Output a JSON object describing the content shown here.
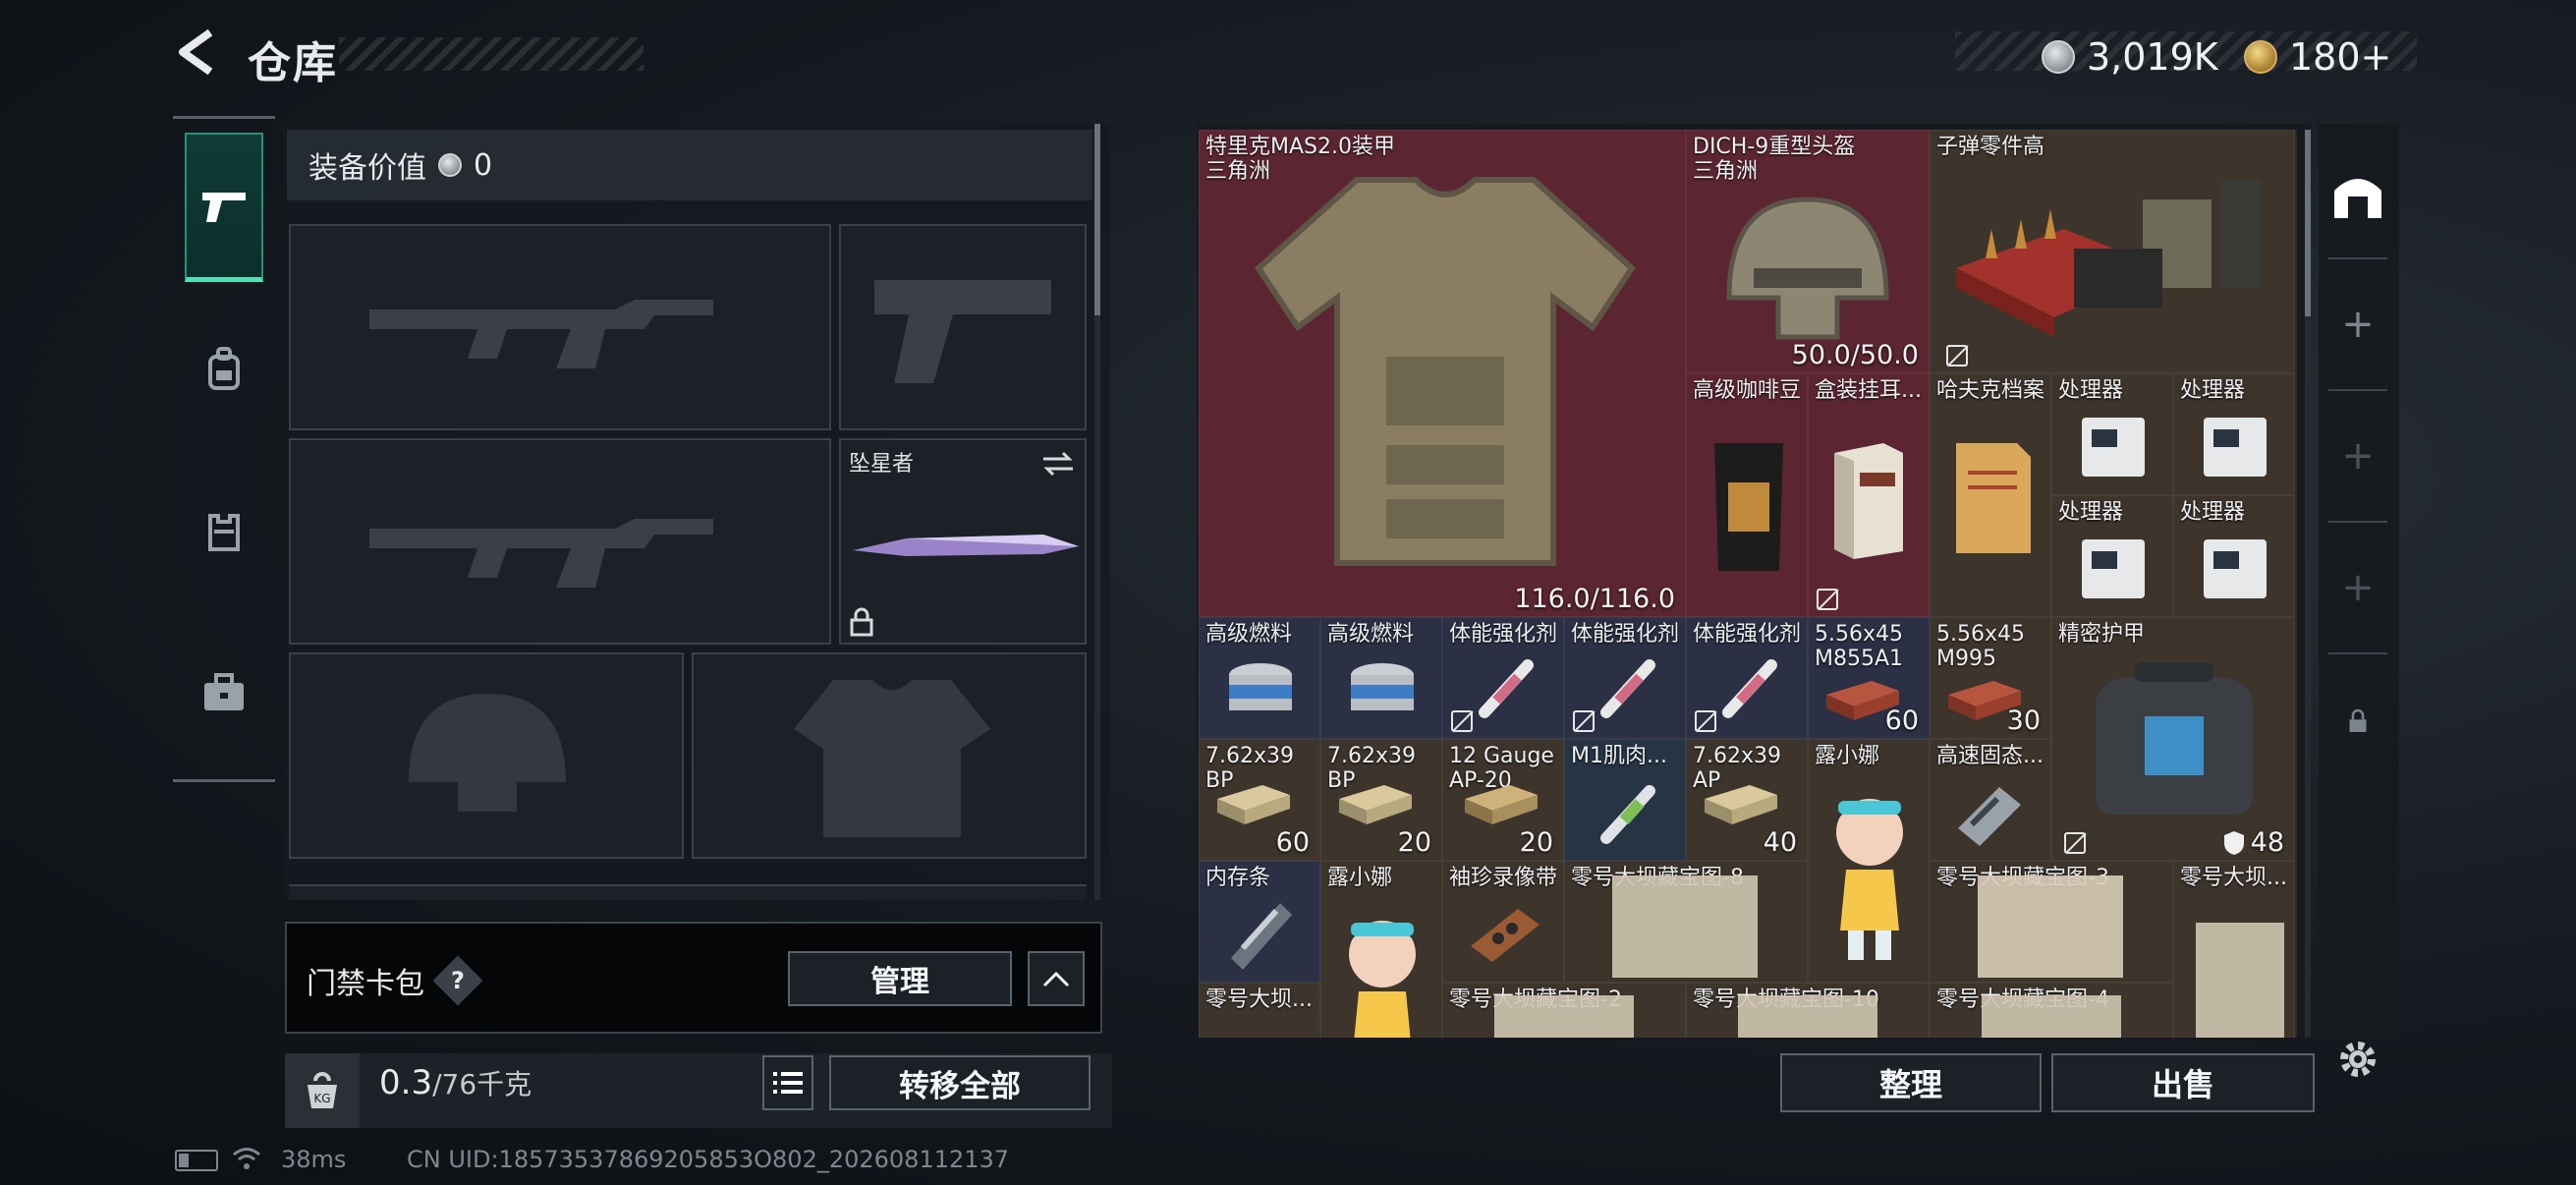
{
  "header": {
    "title": "仓库",
    "currency_silver": "3,019K",
    "currency_gold": "180+"
  },
  "nav": {
    "items": [
      {
        "icon": "pistol-icon",
        "active": true
      },
      {
        "icon": "backpack-icon",
        "active": false
      },
      {
        "icon": "vest-rig-icon",
        "active": false
      },
      {
        "icon": "briefcase-icon",
        "active": false
      }
    ]
  },
  "equipment": {
    "value_label": "装备价值",
    "value": "0",
    "melee_name": "坠星者"
  },
  "card_pack": {
    "label": "门禁卡包",
    "help": "?",
    "manage_label": "管理"
  },
  "weight": {
    "current": "0.3",
    "max": "/76千克",
    "transfer_label": "转移全部"
  },
  "inventory": {
    "armor": {
      "name": "特里克MAS2.0装甲\n三角洲",
      "durability": "116.0/116.0"
    },
    "helmet": {
      "name": "DICH-9重型头盔\n三角洲",
      "durability": "50.0/50.0"
    },
    "ammo_parts": {
      "name": "子弹零件高"
    },
    "coffee": {
      "name": "高级咖啡豆"
    },
    "box_item": {
      "name": "盒装挂耳..."
    },
    "haffke": {
      "name": "哈夫克档案"
    },
    "processors": [
      "处理器",
      "处理器",
      "处理器",
      "处理器"
    ],
    "fuel": [
      "高级燃料",
      "高级燃料"
    ],
    "stim": [
      "体能强化剂",
      "体能强化剂",
      "体能强化剂"
    ],
    "ammo556a": {
      "name": "5.56x45\nM855A1",
      "qty": "60"
    },
    "ammo556b": {
      "name": "5.56x45\nM995",
      "qty": "30"
    },
    "precision_armor": {
      "name": "精密护甲",
      "qty": "48"
    },
    "ammo762bp1": {
      "name": "7.62x39\nBP",
      "qty": "60"
    },
    "ammo762bp2": {
      "name": "7.62x39\nBP",
      "qty": "20"
    },
    "ammo12g": {
      "name": "12 Gauge\nAP-20",
      "qty": "20"
    },
    "m1": {
      "name": "M1肌肉..."
    },
    "ammo762ap": {
      "name": "7.62x39\nAP",
      "qty": "40"
    },
    "luna1": {
      "name": "露小娜"
    },
    "ssd": {
      "name": "高速固态..."
    },
    "ram": {
      "name": "内存条"
    },
    "luna2": {
      "name": "露小娜"
    },
    "tape": {
      "name": "袖珍录像带"
    },
    "maps": [
      "零号大坝藏宝图-8",
      "零号大坝藏宝图-3",
      "零号大坝...",
      "零号大坝...",
      "零号大坝藏宝图-2",
      "零号大坝藏宝图-10",
      "零号大坝藏宝图-4"
    ]
  },
  "actions": {
    "organize_label": "整理",
    "sell_label": "出售"
  },
  "status_bar": {
    "ping": "38ms",
    "uid": "CN UID:18573537869205853O802_202608112137"
  }
}
